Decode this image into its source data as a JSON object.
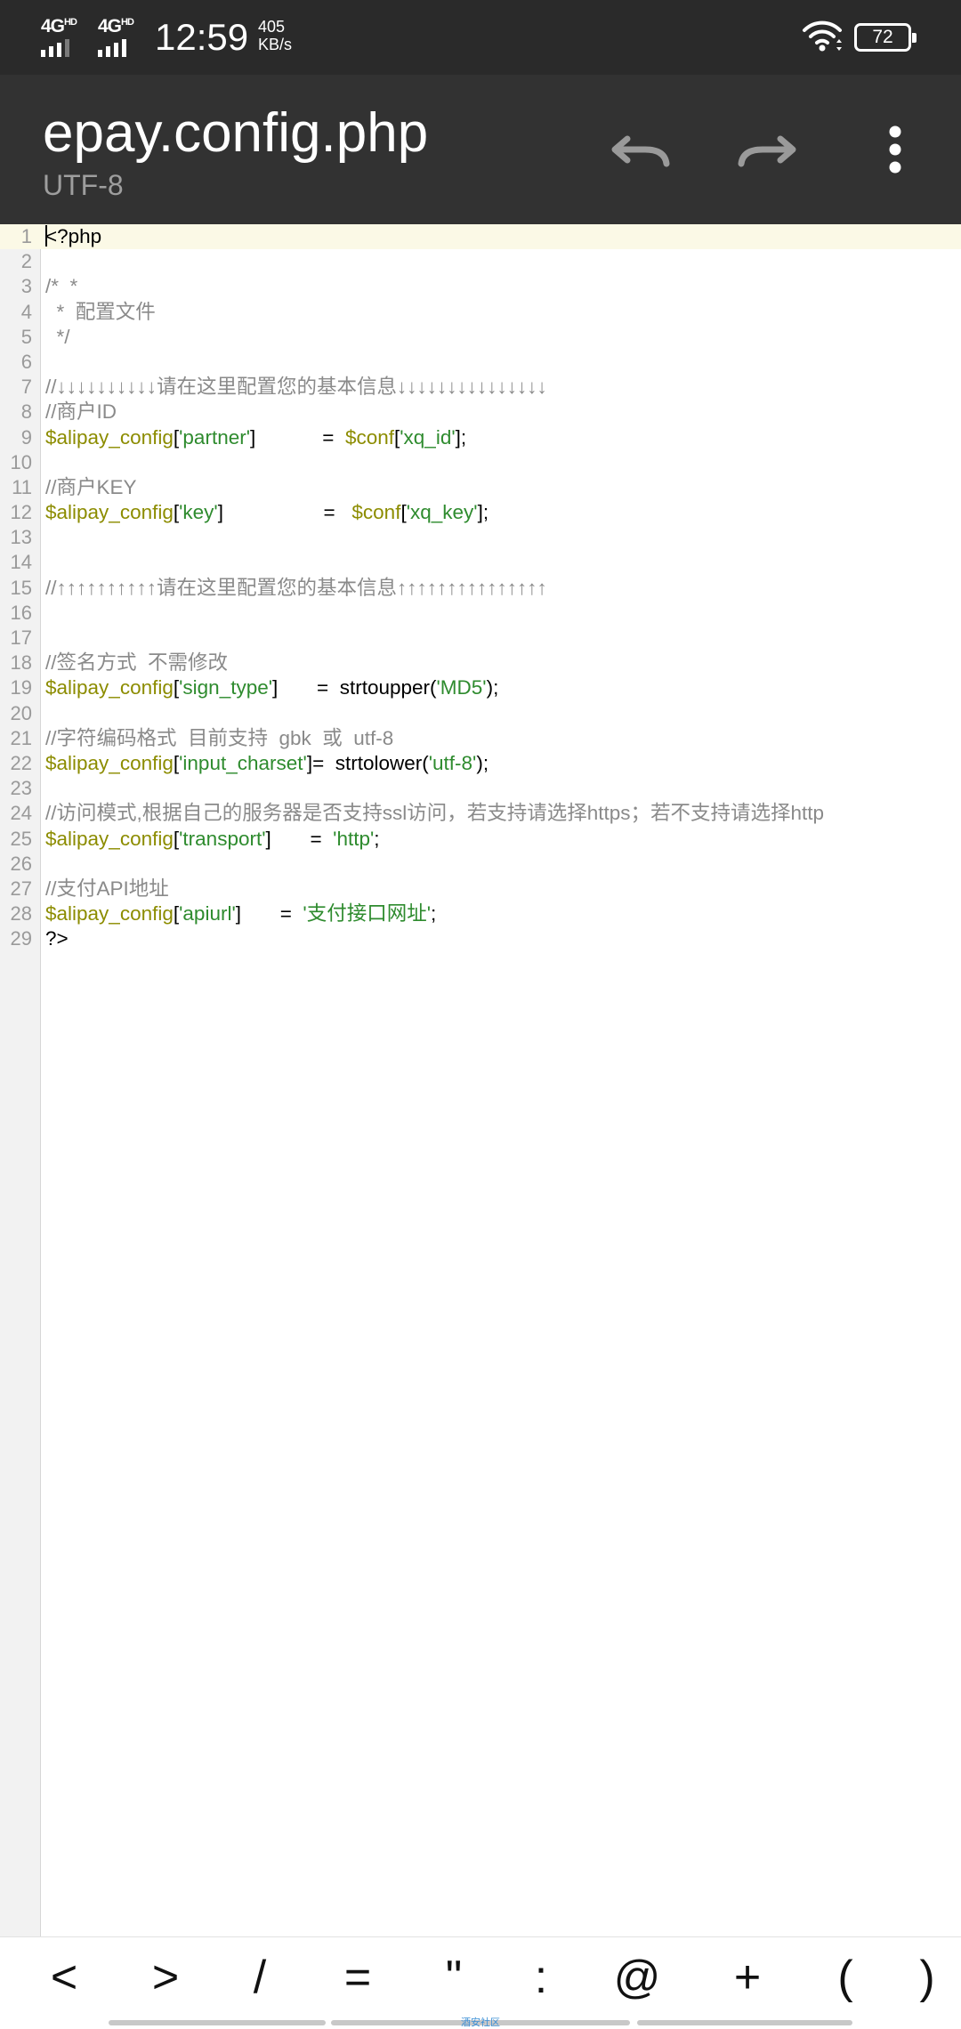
{
  "status_bar": {
    "network_1": "4G",
    "network_1_sup": "HD",
    "network_2": "4G",
    "network_2_sup": "HD",
    "time": "12:59",
    "speed_value": "405",
    "speed_unit": "KB/s",
    "wifi_icon": "wifi-icon",
    "battery_level": "72"
  },
  "app_bar": {
    "file_name": "epay.config.php",
    "encoding": "UTF-8",
    "undo_icon": "undo-icon",
    "redo_icon": "redo-icon",
    "more_icon": "more-vert-icon"
  },
  "editor": {
    "active_line": 1,
    "line_numbers": [
      "1",
      "2",
      "3",
      "4",
      "5",
      "6",
      "7",
      "8",
      "9",
      "10",
      "11",
      "12",
      "13",
      "14",
      "15",
      "16",
      "17",
      "18",
      "19",
      "20",
      "21",
      "22",
      "23",
      "24",
      "25",
      "26",
      "27",
      "28",
      "29"
    ],
    "lines": [
      [
        {
          "t": "<?php",
          "c": "plain"
        }
      ],
      [],
      [
        {
          "t": "/*  *",
          "c": "com"
        }
      ],
      [
        {
          "t": "  *  配置文件",
          "c": "com"
        }
      ],
      [
        {
          "t": "  */",
          "c": "com"
        }
      ],
      [],
      [
        {
          "t": "//↓↓↓↓↓↓↓↓↓↓请在这里配置您的基本信息↓↓↓↓↓↓↓↓↓↓↓↓↓↓↓",
          "c": "com"
        }
      ],
      [
        {
          "t": "//商户ID",
          "c": "com"
        }
      ],
      [
        {
          "t": "$alipay_config",
          "c": "var"
        },
        {
          "t": "[",
          "c": "plain"
        },
        {
          "t": "'partner'",
          "c": "str"
        },
        {
          "t": "]            =  ",
          "c": "plain"
        },
        {
          "t": "$conf",
          "c": "var"
        },
        {
          "t": "[",
          "c": "plain"
        },
        {
          "t": "'xq_id'",
          "c": "str"
        },
        {
          "t": "];",
          "c": "plain"
        }
      ],
      [],
      [
        {
          "t": "//商户KEY",
          "c": "com"
        }
      ],
      [
        {
          "t": "$alipay_config",
          "c": "var"
        },
        {
          "t": "[",
          "c": "plain"
        },
        {
          "t": "'key'",
          "c": "str"
        },
        {
          "t": "]                  =   ",
          "c": "plain"
        },
        {
          "t": "$conf",
          "c": "var"
        },
        {
          "t": "[",
          "c": "plain"
        },
        {
          "t": "'xq_key'",
          "c": "str"
        },
        {
          "t": "];",
          "c": "plain"
        }
      ],
      [],
      [],
      [
        {
          "t": "//↑↑↑↑↑↑↑↑↑↑请在这里配置您的基本信息↑↑↑↑↑↑↑↑↑↑↑↑↑↑↑",
          "c": "com"
        }
      ],
      [],
      [],
      [
        {
          "t": "//签名方式  不需修改",
          "c": "com"
        }
      ],
      [
        {
          "t": "$alipay_config",
          "c": "var"
        },
        {
          "t": "[",
          "c": "plain"
        },
        {
          "t": "'sign_type'",
          "c": "str"
        },
        {
          "t": "]       =  strtoupper(",
          "c": "plain"
        },
        {
          "t": "'MD5'",
          "c": "str"
        },
        {
          "t": ");",
          "c": "plain"
        }
      ],
      [],
      [
        {
          "t": "//字符编码格式  目前支持  gbk  或  utf-8",
          "c": "com"
        }
      ],
      [
        {
          "t": "$alipay_config",
          "c": "var"
        },
        {
          "t": "[",
          "c": "plain"
        },
        {
          "t": "'input_charset'",
          "c": "str"
        },
        {
          "t": "]=  strtolower(",
          "c": "plain"
        },
        {
          "t": "'utf-8'",
          "c": "str"
        },
        {
          "t": ");",
          "c": "plain"
        }
      ],
      [],
      [
        {
          "t": "//访问模式,根据自己的服务器是否支持ssl访问，若支持请选择https；若不支持请选择http",
          "c": "com"
        }
      ],
      [
        {
          "t": "$alipay_config",
          "c": "var"
        },
        {
          "t": "[",
          "c": "plain"
        },
        {
          "t": "'transport'",
          "c": "str"
        },
        {
          "t": "]       =  ",
          "c": "plain"
        },
        {
          "t": "'http'",
          "c": "str"
        },
        {
          "t": ";",
          "c": "plain"
        }
      ],
      [],
      [
        {
          "t": "//支付API地址",
          "c": "com"
        }
      ],
      [
        {
          "t": "$alipay_config",
          "c": "var"
        },
        {
          "t": "[",
          "c": "plain"
        },
        {
          "t": "'apiurl'",
          "c": "str"
        },
        {
          "t": "]       =  ",
          "c": "plain"
        },
        {
          "t": "'支付接口网址'",
          "c": "str"
        },
        {
          "t": ";",
          "c": "plain"
        }
      ],
      [
        {
          "t": "?>",
          "c": "plain"
        }
      ]
    ]
  },
  "symbol_bar": {
    "symbols": [
      "<",
      ">",
      "/",
      "=",
      "\"",
      ":",
      "@",
      "+",
      "(",
      ")"
    ],
    "watermark": "酒安社区"
  },
  "colors": {
    "comment": "#8a8a8a",
    "variable": "#8c8c00",
    "string": "#2e8b2e",
    "active_line_bg": "#fbf9e6",
    "app_bar_bg": "#323232",
    "status_bar_bg": "#2a2a2a"
  }
}
